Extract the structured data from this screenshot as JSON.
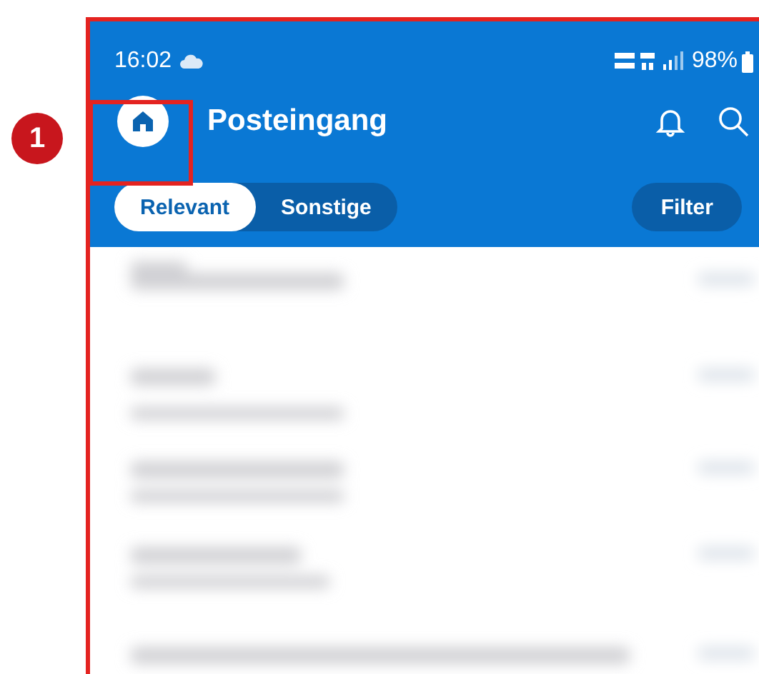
{
  "annotations": [
    {
      "kind": "badge",
      "label": "1"
    },
    {
      "kind": "highlight"
    }
  ],
  "status_bar": {
    "time": "16:02",
    "battery": "98%"
  },
  "header": {
    "title": "Posteingang"
  },
  "tabs": [
    {
      "label": "Relevant",
      "selected": true
    },
    {
      "label": "Sonstige",
      "selected": false
    }
  ],
  "filter_button": {
    "label": "Filter"
  }
}
